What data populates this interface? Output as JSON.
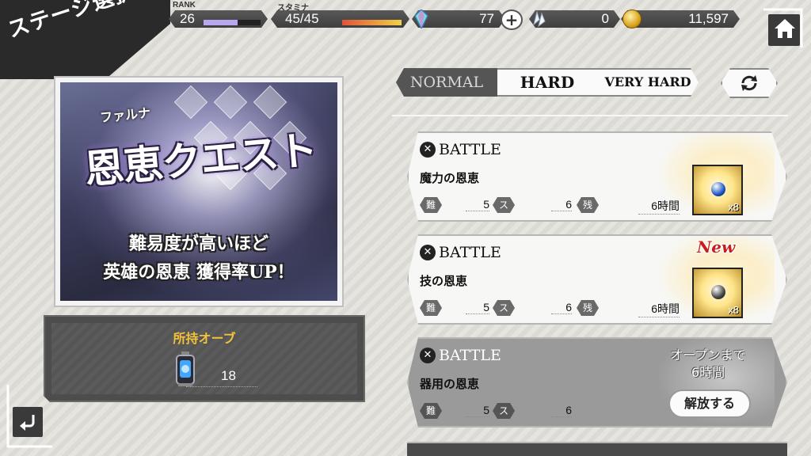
{
  "header": {
    "title": "ステージ選択",
    "rank_label": "RANK",
    "rank_value": "26",
    "rank_progress": 0.6,
    "stamina_label": "スタミナ",
    "stamina_value": "45/45",
    "stamina_progress": 1.0,
    "crystal_count": "77",
    "shard_count": "0",
    "coin_count": "11,597"
  },
  "banner": {
    "ruby": "ファルナ",
    "title": "恩恵クエスト",
    "line1": "難易度が高いほど",
    "line2": "英雄の恩恵 獲得率UP！"
  },
  "orbs": {
    "title": "所持オーブ",
    "count": "18"
  },
  "difficulty_tabs": {
    "normal": "NORMAL",
    "hard": "HARD",
    "very_hard": "VERY HARD",
    "selected": "NORMAL"
  },
  "battles": [
    {
      "head": "BATTLE",
      "name": "魔力の恩恵",
      "difficulty_label": "難易度",
      "difficulty": "5",
      "stamina_label": "スタミナ",
      "stamina": "6",
      "time_label": "残り時間",
      "time": "6時間",
      "reward_mult": "x8",
      "orb_color": "#1e57c9"
    },
    {
      "head": "BATTLE",
      "name": "技の恩恵",
      "difficulty_label": "難易度",
      "difficulty": "5",
      "stamina_label": "スタミナ",
      "stamina": "6",
      "time_label": "残り時間",
      "time": "6時間",
      "reward_mult": "x8",
      "badge": "New",
      "orb_color": "#444444"
    },
    {
      "head": "BATTLE",
      "name": "器用の恩恵",
      "difficulty_label": "難易度",
      "difficulty": "5",
      "stamina_label": "スタミナ",
      "stamina": "6",
      "open_line1": "オープンまで",
      "open_line2": "6時間",
      "unlock_label": "解放する"
    }
  ],
  "icons": {
    "home": "home-icon",
    "back": "back-arrow-icon",
    "refresh": "refresh-icon",
    "plus": "plus-icon",
    "crystal": "crystal-icon",
    "shard": "shard-icon",
    "coin": "coin-icon",
    "orb_lantern": "orb-lantern-icon",
    "battle": "swords-icon"
  }
}
